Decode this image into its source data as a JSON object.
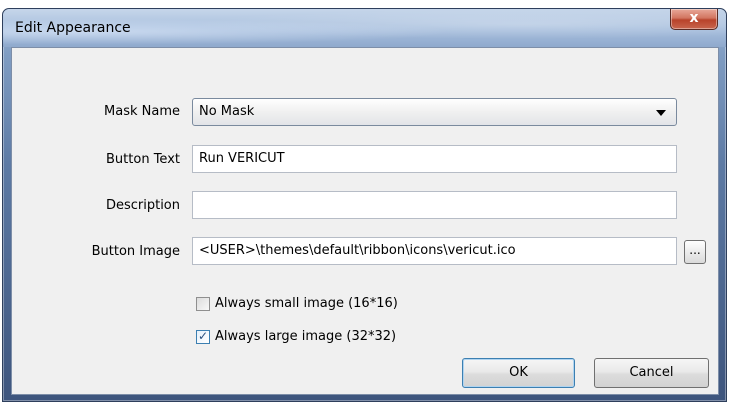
{
  "window": {
    "title": "Edit Appearance",
    "close_glyph": "x"
  },
  "form": {
    "mask_name_label": "Mask Name",
    "mask_name_value": "No Mask",
    "button_text_label": "Button Text",
    "button_text_value": "Run VERICUT",
    "description_label": "Description",
    "description_value": "",
    "button_image_label": "Button Image",
    "button_image_value": "<USER>\\themes\\default\\ribbon\\icons\\vericut.ico",
    "browse_label": "..."
  },
  "options": {
    "small_image_label": "Always small image (16*16)",
    "small_image_checked": false,
    "large_image_label": "Always large image (32*32)",
    "large_image_checked": true
  },
  "buttons": {
    "ok_label": "OK",
    "cancel_label": "Cancel"
  },
  "colors": {
    "accent": "#3c7fb1",
    "close": "#c9543c"
  }
}
